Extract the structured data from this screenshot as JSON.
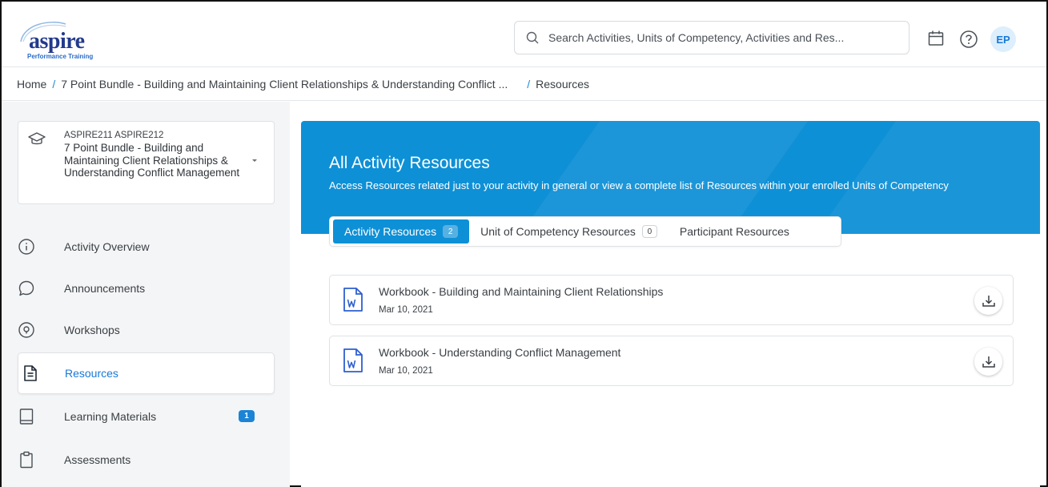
{
  "brand": {
    "name": "aspire",
    "tagline": "Performance Training"
  },
  "search": {
    "placeholder": "Search Activities, Units of Competency, Activities and Res..."
  },
  "header_icons": [
    "calendar-icon",
    "help-icon"
  ],
  "user": {
    "initials": "EP"
  },
  "breadcrumb": {
    "home": "Home",
    "sep": "/",
    "course": "7 Point Bundle - Building and Maintaining Client Relationships & Understanding Conflict ...",
    "current": "Resources"
  },
  "course": {
    "codes": "ASPIRE211 ASPIRE212",
    "title": "7 Point Bundle - Building and Maintaining Client Relationships & Understanding Conflict Management"
  },
  "nav": [
    {
      "label": "Activity Overview",
      "icon": "info-icon"
    },
    {
      "label": "Announcements",
      "icon": "chat-bubble-icon"
    },
    {
      "label": "Workshops",
      "icon": "location-pin-icon"
    },
    {
      "label": "Resources",
      "icon": "document-icon",
      "active": true
    },
    {
      "label": "Learning Materials",
      "icon": "book-icon",
      "count": "1"
    },
    {
      "label": "Assessments",
      "icon": "clipboard-icon"
    }
  ],
  "banner": {
    "title": "All Activity Resources",
    "subtitle": "Access Resources related just to your activity in general or view a complete list of Resources within your enrolled Units of Competency"
  },
  "tabs": [
    {
      "label": "Activity Resources",
      "count": "2",
      "active": true
    },
    {
      "label": "Unit of Competency Resources",
      "count": "0"
    },
    {
      "label": "Participant Resources"
    }
  ],
  "resources": [
    {
      "name": "Workbook - Building and Maintaining Client Relationships",
      "date": "Mar 10, 2021",
      "icon": "word-document-icon"
    },
    {
      "name": "Workbook - Understanding Conflict Management",
      "date": "Mar 10, 2021",
      "icon": "word-document-icon"
    }
  ],
  "colors": {
    "accent": "#0e90d6",
    "brand": "#223a8c",
    "badge": "#1b84d6"
  }
}
